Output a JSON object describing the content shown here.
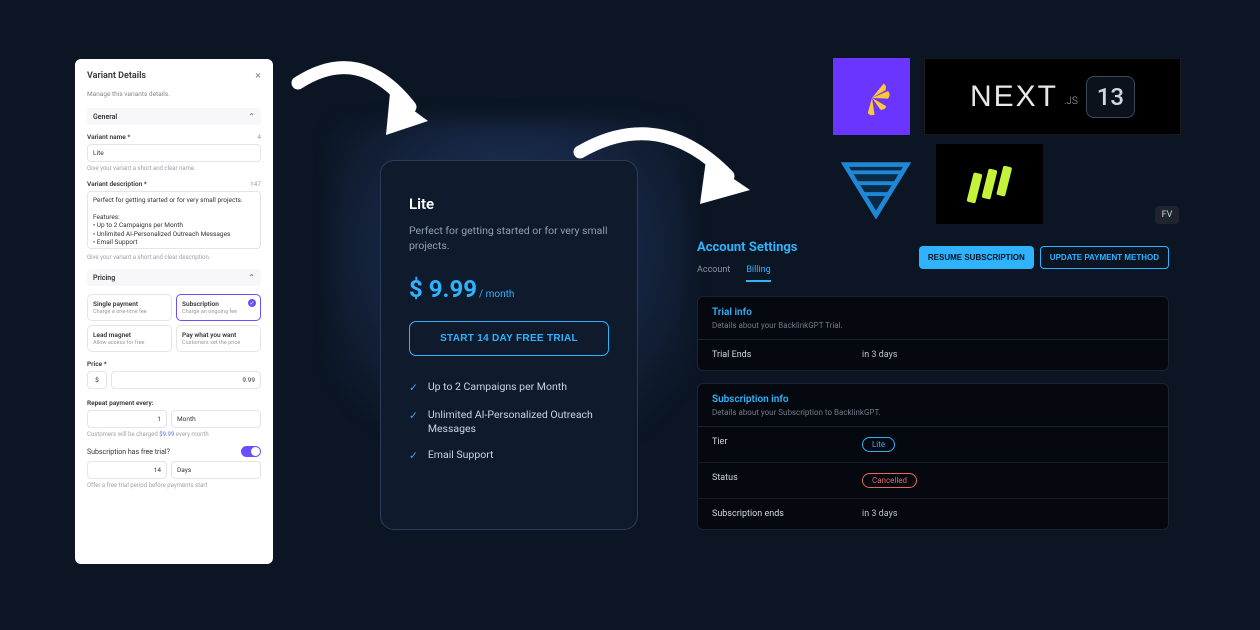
{
  "variant_panel": {
    "title": "Variant Details",
    "subtitle": "Manage this variants details.",
    "section_general": "General",
    "name_label": "Variant name *",
    "name_count": "4",
    "name_value": "Lite",
    "name_hint": "Give your variant a short and clear name.",
    "desc_label": "Variant description *",
    "desc_count": "147",
    "desc_value": "Perfect for getting started or for very small projects.\n\nFeatures:\n• Up to 2 Campaigns per Month\n• Unlimited AI-Personalized Outreach Messages\n• Email Support",
    "desc_hint": "Give your variant a short and clear description.",
    "section_pricing": "Pricing",
    "options": [
      {
        "title": "Single payment",
        "sub": "Charge a one-time fee"
      },
      {
        "title": "Subscription",
        "sub": "Charge an ongoing fee"
      },
      {
        "title": "Lead magnet",
        "sub": "Allow access for free"
      },
      {
        "title": "Pay what you want",
        "sub": "Customers set the price"
      }
    ],
    "selected_option_index": 1,
    "price_label": "Price *",
    "price_currency": "$",
    "price_value": "9.99",
    "repeat_label": "Repeat payment every:",
    "repeat_interval_value": "1",
    "repeat_unit": "Month",
    "repeat_hint_pre": "Customers will be charged ",
    "repeat_hint_amount": "$9.99",
    "repeat_hint_post": " every month",
    "trial_toggle_label": "Subscription has free trial?",
    "trial_toggle_on": true,
    "trial_days_value": "14",
    "trial_unit": "Days",
    "trial_hint": "Offer a free trial period before payments start"
  },
  "pricing_card": {
    "tier": "Lite",
    "desc": "Perfect for getting started or for very small projects.",
    "price": "$ 9.99",
    "per": "/ month",
    "cta": "START 14 DAY FREE TRIAL",
    "features": [
      "Up to 2 Campaigns per Month",
      "Unlimited AI-Personalized Outreach Messages",
      "Email Support"
    ]
  },
  "logos": {
    "next_text": "NEXT",
    "next_js": ".JS",
    "next_badge": "13",
    "fv": "FV"
  },
  "account": {
    "title": "Account Settings",
    "actions": {
      "resume": "RESUME SUBSCRIPTION",
      "update": "UPDATE PAYMENT METHOD"
    },
    "tabs": {
      "account": "Account",
      "billing": "Billing"
    },
    "trial_card": {
      "title": "Trial info",
      "sub": "Details about your BacklinkGPT Trial.",
      "rows": [
        {
          "k": "Trial Ends",
          "v": "in 3 days"
        }
      ]
    },
    "sub_card": {
      "title": "Subscription info",
      "sub": "Details about your Subscription to BacklinkGPT.",
      "tier_label": "Tier",
      "tier_value": "Lite",
      "status_label": "Status",
      "status_value": "Cancelled",
      "ends_label": "Subscription ends",
      "ends_value": "in 3 days"
    }
  }
}
